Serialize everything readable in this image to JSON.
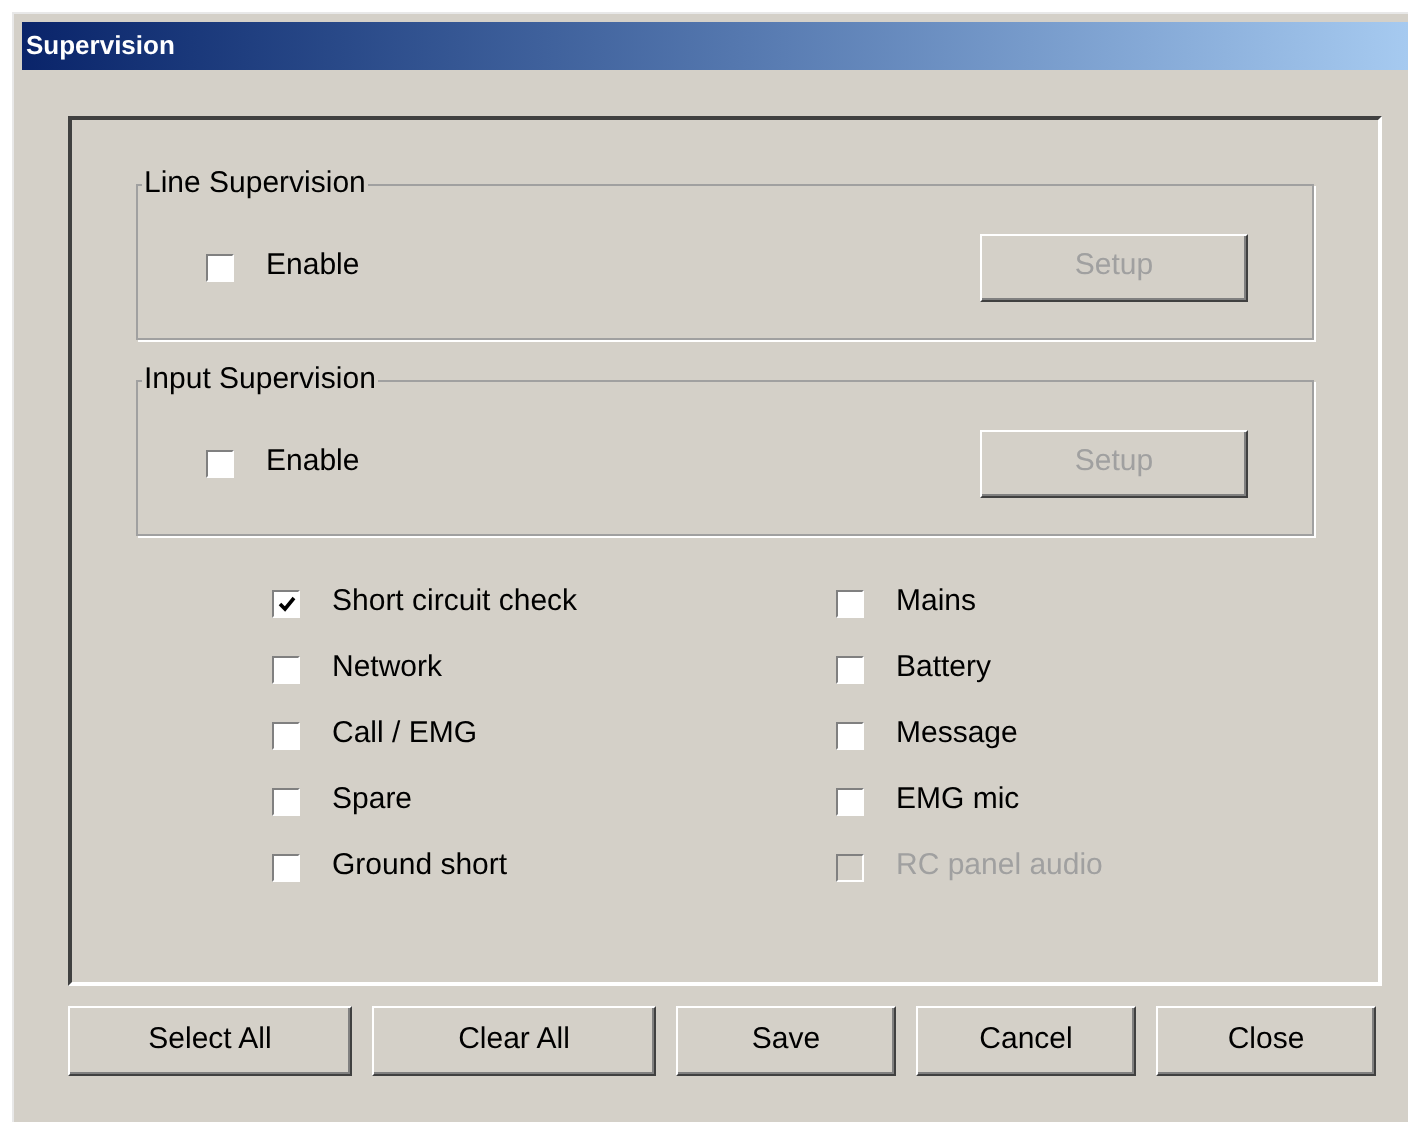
{
  "window": {
    "title": "Supervision"
  },
  "groups": [
    {
      "title": "Line Supervision",
      "enable": {
        "label": "Enable",
        "checked": false
      },
      "setup": {
        "label": "Setup",
        "disabled": true
      }
    },
    {
      "title": "Input Supervision",
      "enable": {
        "label": "Enable",
        "checked": false
      },
      "setup": {
        "label": "Setup",
        "disabled": true
      }
    }
  ],
  "checks": [
    {
      "label": "Short circuit check",
      "checked": true,
      "disabled": false
    },
    {
      "label": "Mains",
      "checked": false,
      "disabled": false
    },
    {
      "label": "Network",
      "checked": false,
      "disabled": false
    },
    {
      "label": "Battery",
      "checked": false,
      "disabled": false
    },
    {
      "label": "Call / EMG",
      "checked": false,
      "disabled": false
    },
    {
      "label": "Message",
      "checked": false,
      "disabled": false
    },
    {
      "label": "Spare",
      "checked": false,
      "disabled": false
    },
    {
      "label": "EMG mic",
      "checked": false,
      "disabled": false
    },
    {
      "label": "Ground short",
      "checked": false,
      "disabled": false
    },
    {
      "label": "RC panel audio",
      "checked": false,
      "disabled": true
    }
  ],
  "buttons": [
    "Select All",
    "Clear All",
    "Save",
    "Cancel",
    "Close"
  ]
}
